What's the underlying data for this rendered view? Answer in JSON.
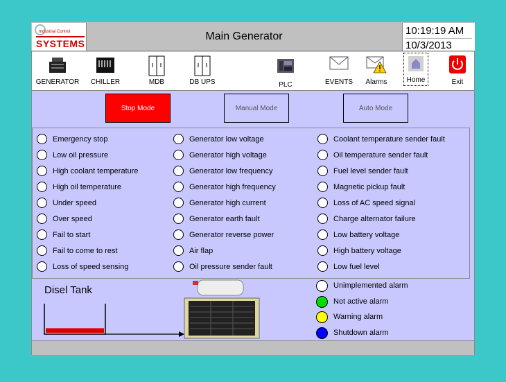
{
  "header": {
    "logo_small": "Industrial Control",
    "logo_main": "SYSTEMS",
    "title": "Main Generator",
    "time": "10:19:19 AM",
    "date": "10/3/2013"
  },
  "nav": [
    {
      "label": "GENERATOR",
      "icon": "generator-icon"
    },
    {
      "label": "CHILLER",
      "icon": "chiller-icon"
    },
    {
      "label": "MDB",
      "icon": "cabinet-icon"
    },
    {
      "label": "DB UPS",
      "icon": "cabinet-icon"
    },
    {
      "label": "PLC",
      "icon": "plc-icon"
    },
    {
      "label": "EVENTS",
      "icon": "envelope-icon"
    },
    {
      "label": "Alarms",
      "icon": "alarm-envelope-icon"
    },
    {
      "label": "Home",
      "icon": "home-icon"
    },
    {
      "label": "Exit",
      "icon": "power-icon"
    }
  ],
  "modes": {
    "stop": "Stop Mode",
    "manual": "Manual Mode",
    "auto": "Auto Mode"
  },
  "alarms": {
    "col1": [
      "Emergency stop",
      "Low oil pressure",
      "High coolant temperature",
      "High oil temperature",
      "Under speed",
      "Over speed",
      "Fail to start",
      "Fail to come to rest",
      "Loss of speed sensing"
    ],
    "col2": [
      "Generator low voltage",
      "Generator high voltage",
      "Generator low frequency",
      "Generator high frequency",
      "Generator high current",
      "Generator earth fault",
      "Generator reverse power",
      "Air flap",
      "Oil pressure sender fault"
    ],
    "col3": [
      "Coolant temperature sender fault",
      "Oil temperature sender fault",
      "Fuel level sender fault",
      "Magnetic pickup fault",
      "Loss of AC speed signal",
      "Charge alternator failure",
      "Low battery voltage",
      "High battery voltage",
      "Low fuel level"
    ]
  },
  "tank": {
    "title": "Disel Tank",
    "level": 0.15
  },
  "legend": [
    {
      "label": "Unimplemented alarm",
      "color": "#ffffff"
    },
    {
      "label": "Not active alarm",
      "color": "#00dd00"
    },
    {
      "label": "Warning alarm",
      "color": "#ffff00"
    },
    {
      "label": "Shutdown alarm",
      "color": "#0000ff"
    }
  ],
  "colors": {
    "stop_active": "#ff0000",
    "background": "#3cc8c8",
    "panel": "#c8c8ff"
  }
}
